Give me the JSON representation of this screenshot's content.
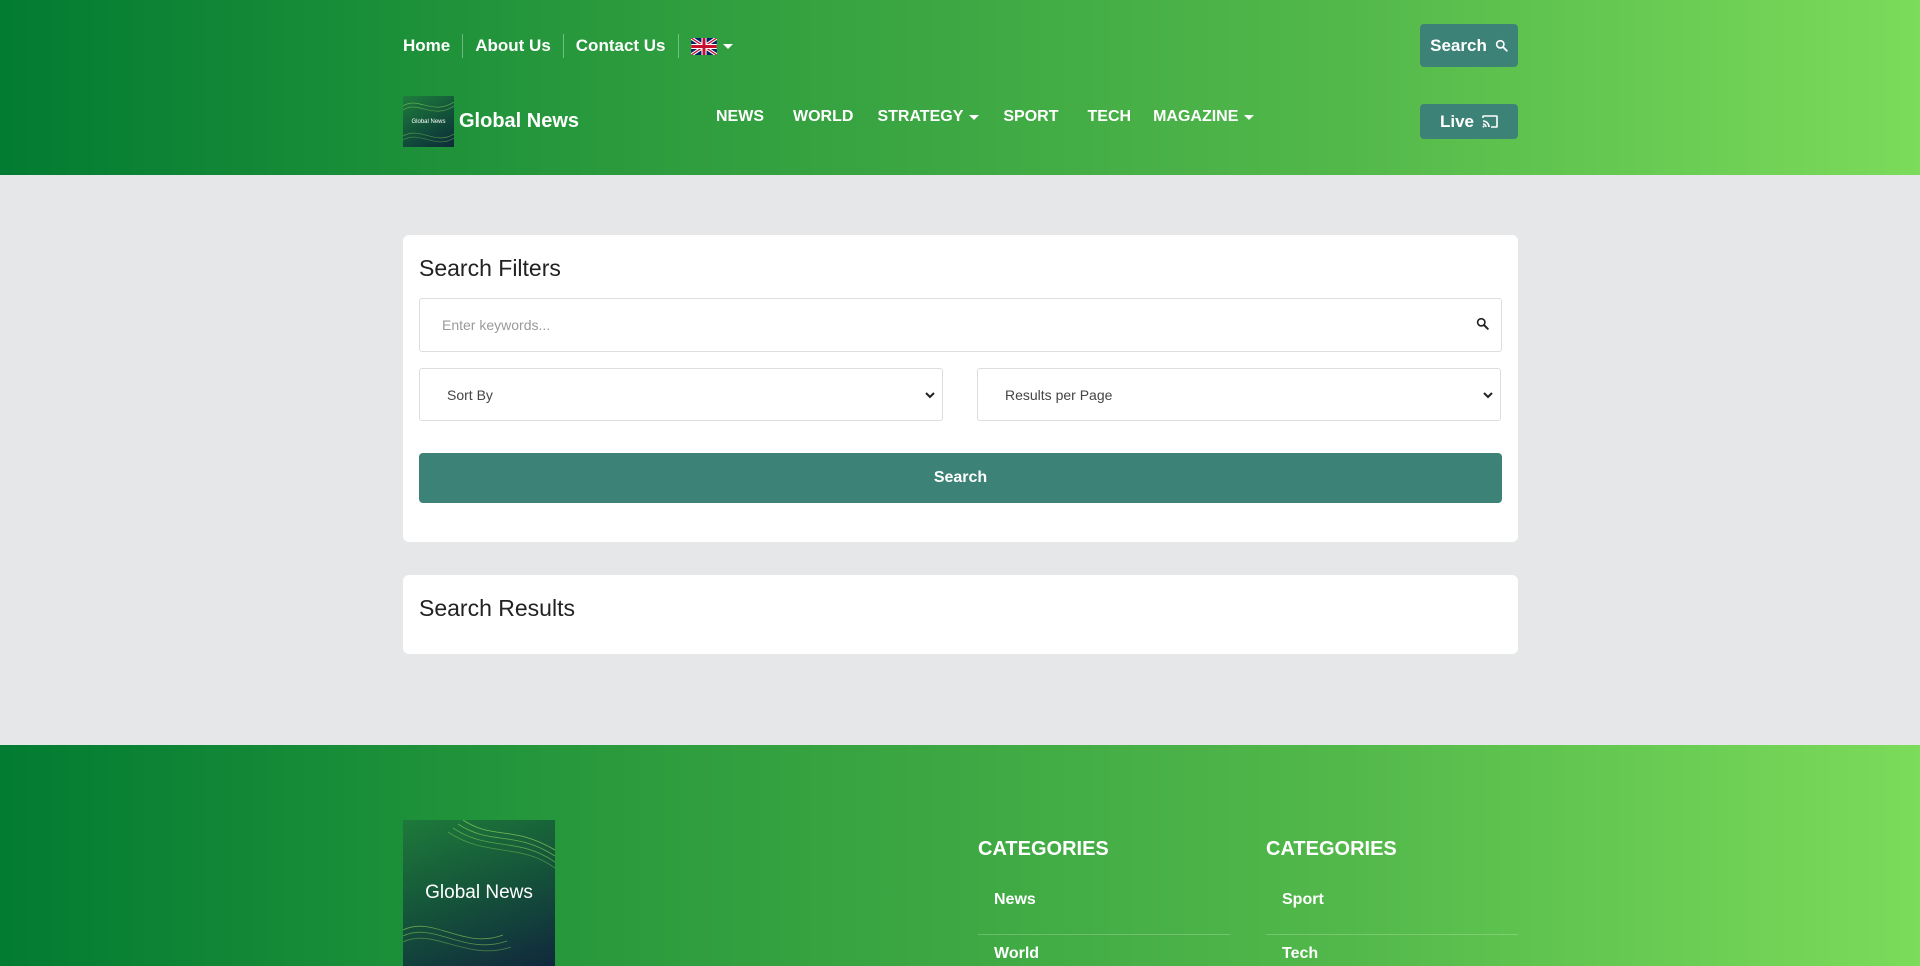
{
  "header": {
    "top_nav": [
      "Home",
      "About Us",
      "Contact Us"
    ],
    "language_flag": "uk-flag-icon",
    "search_button": "Search",
    "brand": {
      "logo_text": "Global News",
      "name": "Global News"
    },
    "main_nav": [
      {
        "label": "NEWS",
        "dropdown": false
      },
      {
        "label": "WORLD",
        "dropdown": false
      },
      {
        "label": "STRATEGY",
        "dropdown": true
      },
      {
        "label": "SPORT",
        "dropdown": false
      },
      {
        "label": "TECH",
        "dropdown": false
      },
      {
        "label": "MAGAZINE",
        "dropdown": true
      }
    ],
    "live_button": "Live"
  },
  "filters": {
    "title": "Search Filters",
    "keyword_placeholder": "Enter keywords...",
    "sort_by": "Sort By",
    "results_per_page": "Results per Page",
    "submit": "Search"
  },
  "results": {
    "title": "Search Results"
  },
  "footer": {
    "logo_text": "Global News",
    "columns": [
      {
        "title": "CATEGORIES",
        "links": [
          "News",
          "World"
        ]
      },
      {
        "title": "CATEGORIES",
        "links": [
          "Sport",
          "Tech"
        ]
      }
    ]
  },
  "colors": {
    "gradient_start": "#027c32",
    "gradient_end": "#7bdb5a",
    "accent_teal": "#3d8276",
    "page_background": "#e5e7e9"
  }
}
